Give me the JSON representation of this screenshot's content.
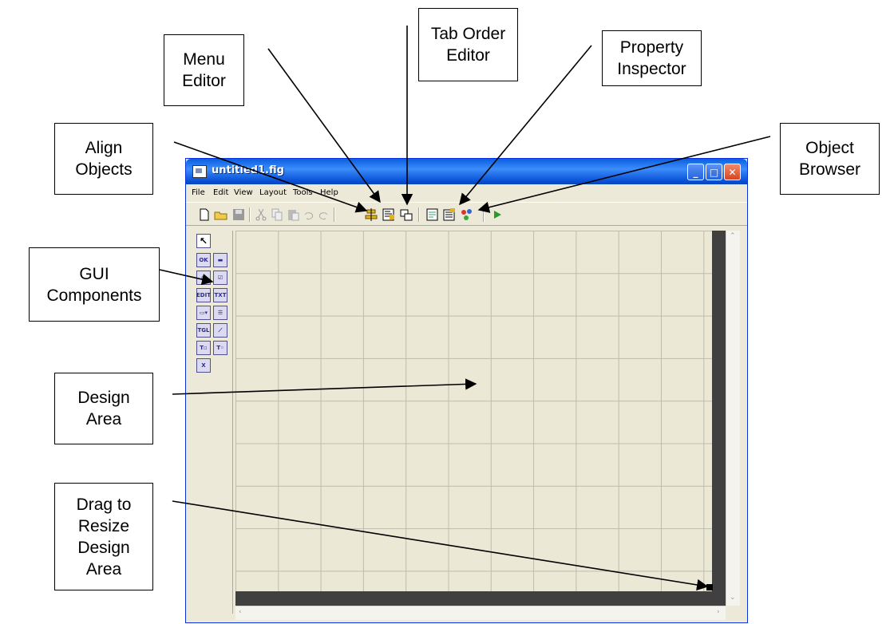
{
  "callouts": {
    "menu_editor": "Menu\nEditor",
    "tab_order_editor": "Tab Order\nEditor",
    "property_inspector": "Property\nInspector",
    "align_objects": "Align\nObjects",
    "object_browser": "Object\nBrowser",
    "gui_components": "GUI\nComponents",
    "design_area": "Design\nArea",
    "drag_to_resize": "Drag to\nResize\nDesign\nArea"
  },
  "window": {
    "title": "untitled1.fig",
    "minimize_glyph": "_",
    "maximize_glyph": "□",
    "close_glyph": "✕"
  },
  "menu": [
    "File",
    "Edit",
    "View",
    "Layout",
    "Tools",
    "Help"
  ],
  "toolbar": {
    "icons": [
      "new-file-icon",
      "open-folder-icon",
      "save-icon",
      "cut-icon",
      "copy-icon",
      "paste-icon",
      "undo-icon",
      "redo-icon",
      "align-objects-icon",
      "menu-editor-icon",
      "tab-order-editor-icon",
      "m-file-editor-icon",
      "property-inspector-icon",
      "object-browser-icon",
      "run-icon"
    ]
  },
  "palette": {
    "items": [
      {
        "icon": "select-arrow-icon",
        "text": "↖"
      },
      {
        "icon": "push-button-icon",
        "text": "OK"
      },
      {
        "icon": "slider-icon",
        "text": "▬"
      },
      {
        "icon": "radio-button-icon",
        "text": "◉"
      },
      {
        "icon": "checkbox-icon",
        "text": "☑"
      },
      {
        "icon": "edit-text-icon",
        "text": "EDIT"
      },
      {
        "icon": "static-text-icon",
        "text": "TXT"
      },
      {
        "icon": "popup-menu-icon",
        "text": "▭▾"
      },
      {
        "icon": "listbox-icon",
        "text": "☰"
      },
      {
        "icon": "toggle-button-icon",
        "text": "TGL"
      },
      {
        "icon": "axes-icon",
        "text": "⟋"
      },
      {
        "icon": "panel-icon",
        "text": "T▫"
      },
      {
        "icon": "button-group-icon",
        "text": "T◦"
      },
      {
        "icon": "activex-icon",
        "text": "X"
      }
    ]
  },
  "colors": {
    "titlebar": "#0a5fe0",
    "window_face": "#ece9d8",
    "design_grid": "#bfbcab",
    "resize_edge": "#404040",
    "run_green": "#2a9a2a"
  }
}
